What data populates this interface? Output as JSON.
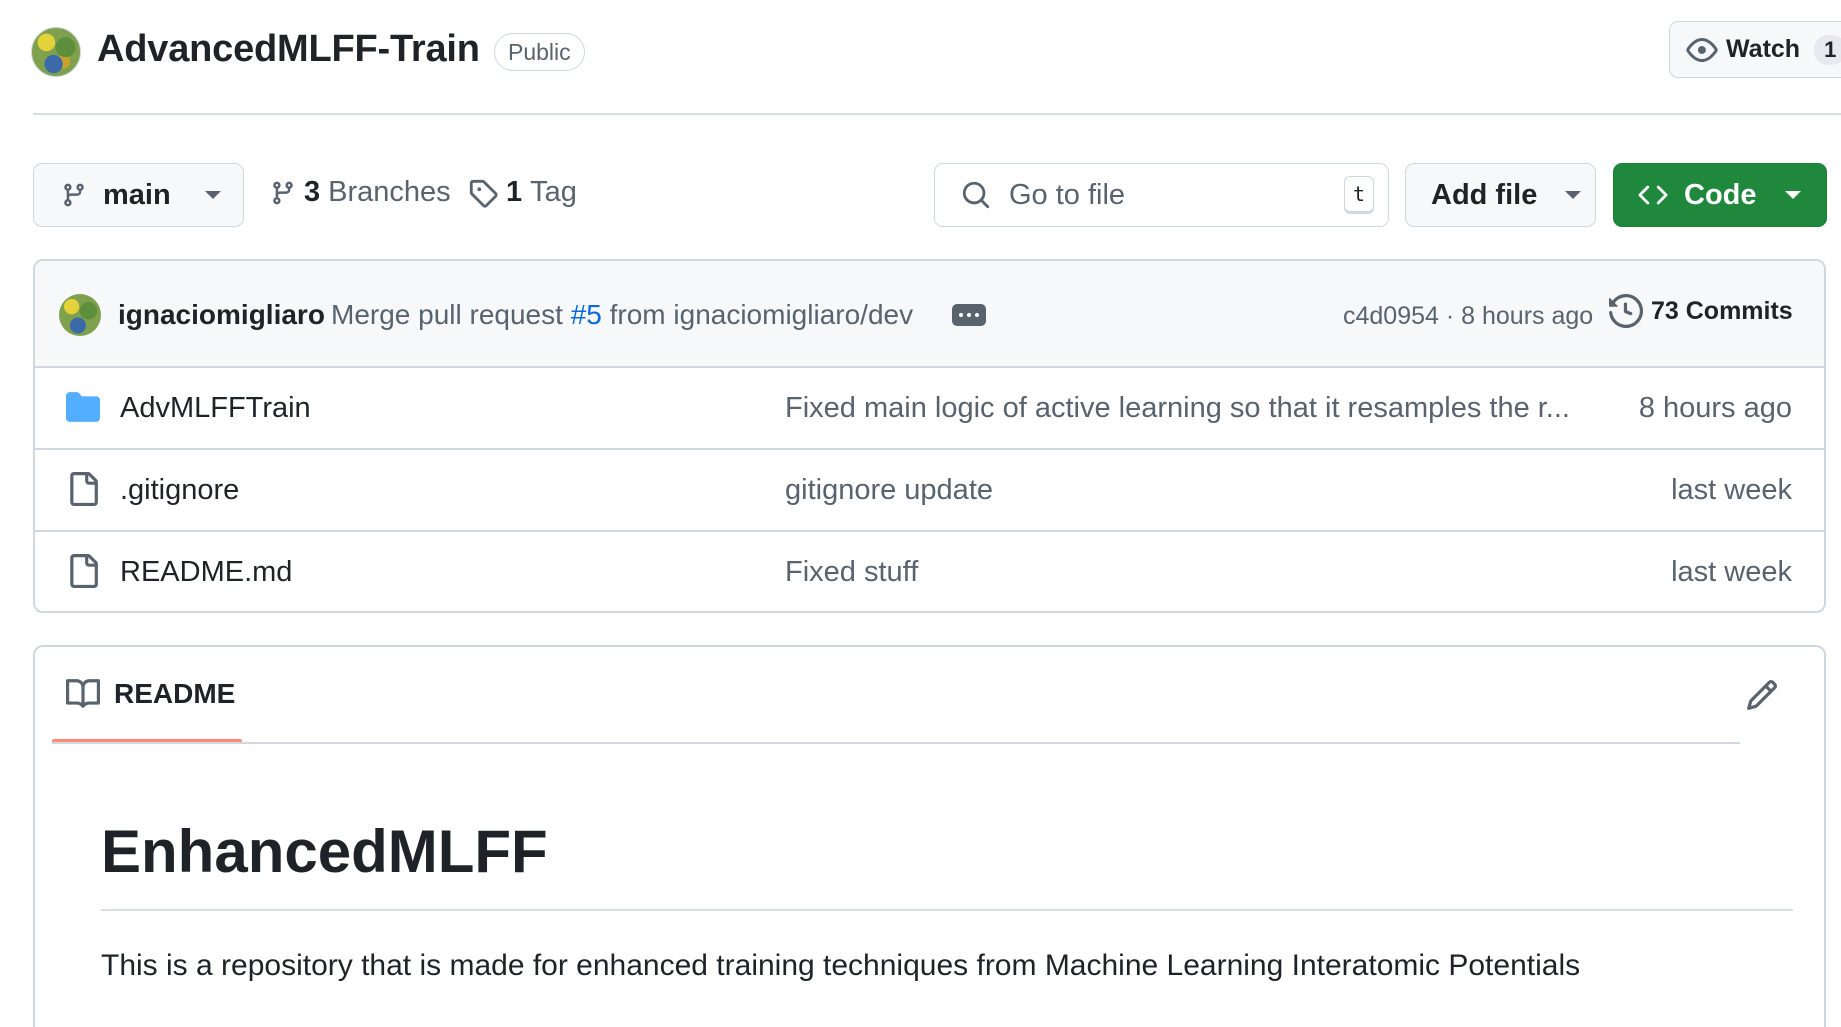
{
  "repo": {
    "name": "AdvancedMLFF-Train",
    "visibility": "Public",
    "watch_label": "Watch",
    "watch_count": "1"
  },
  "toolbar": {
    "branch": "main",
    "branches_count": "3",
    "branches_label": "Branches",
    "tags_count": "1",
    "tags_label": "Tag",
    "search_placeholder": "Go to file",
    "search_shortcut": "t",
    "add_file_label": "Add file",
    "code_label": "Code"
  },
  "latest_commit": {
    "author": "ignaciomigliaro",
    "message_prefix": "Merge pull request ",
    "pr_ref": "#5",
    "message_suffix": " from ignaciomigliaro/dev",
    "meta": "c4d0954 · 8 hours ago",
    "commits_label": "73 Commits"
  },
  "files": [
    {
      "name": "AdvMLFFTrain",
      "type": "folder",
      "message": "Fixed main logic of active learning so that it resamples the r...",
      "age": "8 hours ago"
    },
    {
      "name": ".gitignore",
      "type": "file",
      "message": "gitignore update",
      "age": "last week"
    },
    {
      "name": "README.md",
      "type": "file",
      "message": "Fixed stuff",
      "age": "last week"
    }
  ],
  "readme": {
    "tab_label": "README",
    "heading": "EnhancedMLFF",
    "paragraph": "This is a repository that is made for enhanced training techniques from Machine Learning Interatomic Potentials"
  },
  "colors": {
    "primary_button": "#1f883d",
    "link": "#0969da",
    "folder_icon": "#54aeff",
    "tab_underline": "#fd8c73"
  },
  "icons": [
    "eye-icon",
    "branch-icon",
    "tag-icon",
    "search-icon",
    "code-icon",
    "history-icon",
    "folder-icon",
    "file-icon",
    "book-icon",
    "pencil-icon",
    "ellipsis-icon"
  ]
}
